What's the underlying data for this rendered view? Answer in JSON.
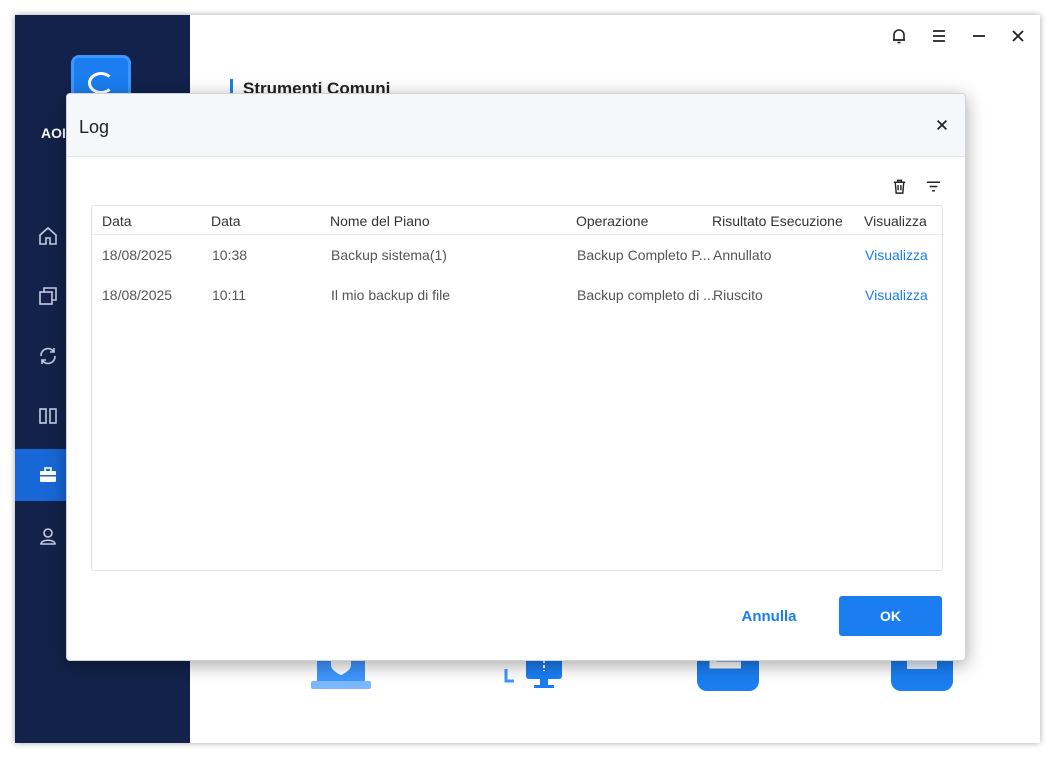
{
  "app": {
    "name": "AOI"
  },
  "main": {
    "section_title": "Strumenti Comuni"
  },
  "dialog": {
    "title": "Log",
    "columns": [
      "Data",
      "Data",
      "Nome del Piano",
      "Operazione",
      "Risultato Esecuzione",
      "Visualizza"
    ],
    "rows": [
      {
        "date": "18/08/2025",
        "time": "10:38",
        "plan": "Backup sistema(1)",
        "operation": "Backup Completo P...",
        "result": "Annullato",
        "view": "Visualizza"
      },
      {
        "date": "18/08/2025",
        "time": "10:11",
        "plan": "Il mio backup di file",
        "operation": "Backup completo di ...",
        "result": "Riuscito",
        "view": "Visualizza"
      }
    ],
    "cancel_label": "Annulla",
    "ok_label": "OK"
  },
  "colors": {
    "accent": "#1a7ef0",
    "sidebar": "#12224a",
    "sidebar_active": "#1768d6"
  },
  "icons": {
    "sidebar": [
      "home-icon",
      "backup-icon",
      "sync-icon",
      "clone-icon",
      "tools-icon",
      "user-icon"
    ],
    "titlebar": [
      "bell-icon",
      "menu-icon",
      "minimize-icon",
      "close-icon"
    ],
    "dialog_tools": [
      "trash-icon",
      "filter-icon"
    ]
  }
}
